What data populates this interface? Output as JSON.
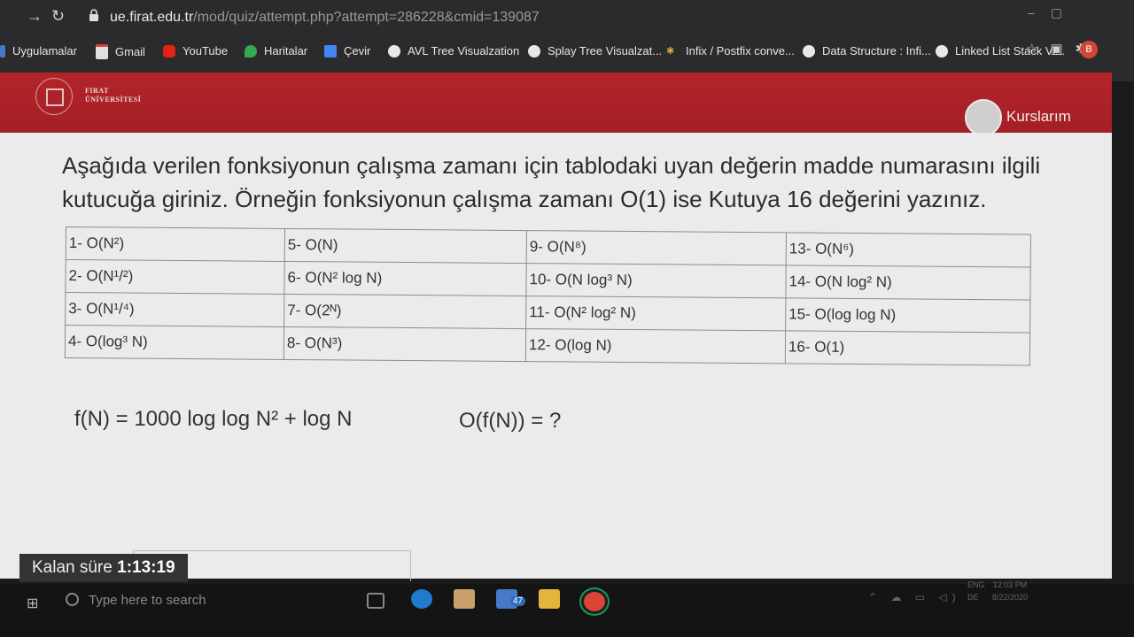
{
  "browser": {
    "url_host": "ue.firat.edu.tr",
    "url_path": "/mod/quiz/attempt.php?attempt=286228&cmid=139087",
    "bookmarks": [
      {
        "label": "Uygulamalar",
        "icon": "apps-icon"
      },
      {
        "label": "Gmail",
        "icon": "gmail-icon"
      },
      {
        "label": "YouTube",
        "icon": "youtube-icon"
      },
      {
        "label": "Haritalar",
        "icon": "maps-icon"
      },
      {
        "label": "Çevir",
        "icon": "translate-icon"
      },
      {
        "label": "AVL Tree Visualzation",
        "icon": "globe-icon"
      },
      {
        "label": "Splay Tree Visualzat...",
        "icon": "globe-icon"
      },
      {
        "label": "Infix / Postfix conve...",
        "icon": "star-icon"
      },
      {
        "label": "Data Structure : Infi...",
        "icon": "globe-icon"
      },
      {
        "label": "Linked List Stack Vi...",
        "icon": "globe-icon"
      }
    ],
    "profile_initial": "B"
  },
  "site": {
    "logo_line1": "FIRAT",
    "logo_line2": "ÜNİVERSİTESİ",
    "courses_label": "Kurslarım",
    "brand_color": "#a81f26"
  },
  "question": {
    "text": "Aşağıda verilen fonksiyonun çalışma zamanı için tablodaki uyan değerin madde numarasını ilgili kutucuğa giriniz. Örneğin fonksiyonun çalışma zamanı O(1) ise Kutuya 16 değerini yazınız.",
    "options": [
      [
        "1- O(N²)",
        "5- O(N)",
        "9- O(N⁸)",
        "13- O(N⁶)"
      ],
      [
        "2- O(N¹/²)",
        "6- O(N² log N)",
        "10- O(N log³ N)",
        "14- O(N log² N)"
      ],
      [
        "3- O(N¹/⁴)",
        "7- O(2ᴺ)",
        "11- O(N² log² N)",
        "15- O(log log N)"
      ],
      [
        "4- O(log³ N)",
        "8- O(N³)",
        "12- O(log N)",
        "16- O(1)"
      ]
    ],
    "formula": "f(N) =  1000 log log N² + log N",
    "answer_label": "O(f(N)) = ?"
  },
  "timer": {
    "label": "Kalan süre",
    "value": "1:13:19"
  },
  "taskbar": {
    "search_placeholder": "Type here to search",
    "mail_count": "47",
    "lang_top": "ENG",
    "lang_bottom": "DE",
    "time": "12:03 PM",
    "date": "8/22/2020"
  }
}
